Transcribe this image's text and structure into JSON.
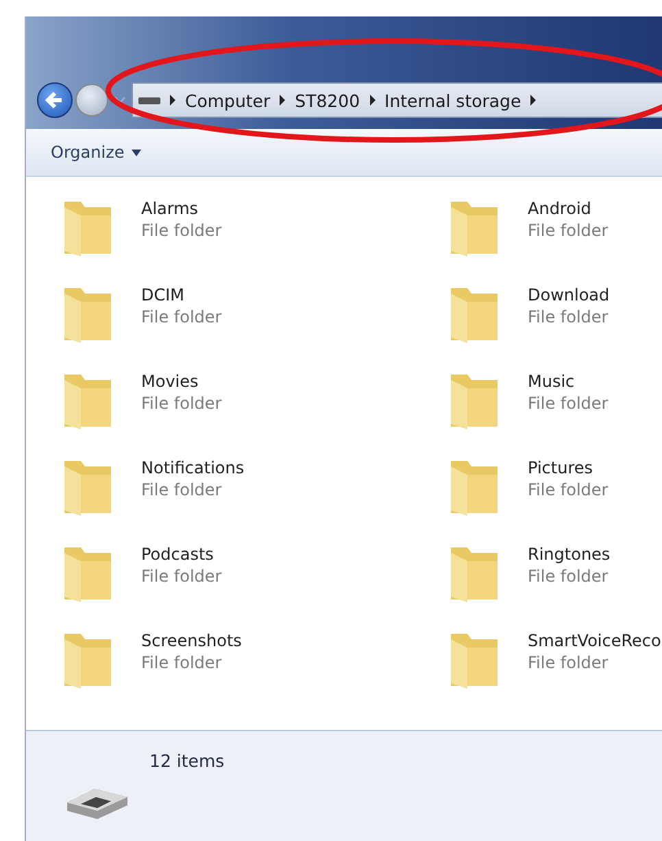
{
  "address_bar": {
    "segments": [
      "Computer",
      "ST8200",
      "Internal storage"
    ]
  },
  "toolbar": {
    "organize": "Organize"
  },
  "items": [
    {
      "name": "Alarms",
      "type": "File folder"
    },
    {
      "name": "Android",
      "type": "File folder"
    },
    {
      "name": "DCIM",
      "type": "File folder"
    },
    {
      "name": "Download",
      "type": "File folder"
    },
    {
      "name": "Movies",
      "type": "File folder"
    },
    {
      "name": "Music",
      "type": "File folder"
    },
    {
      "name": "Notifications",
      "type": "File folder"
    },
    {
      "name": "Pictures",
      "type": "File folder"
    },
    {
      "name": "Podcasts",
      "type": "File folder"
    },
    {
      "name": "Ringtones",
      "type": "File folder"
    },
    {
      "name": "Screenshots",
      "type": "File folder"
    },
    {
      "name": "SmartVoiceReco",
      "type": "File folder"
    }
  ],
  "status_bar": {
    "count": "12 items"
  }
}
